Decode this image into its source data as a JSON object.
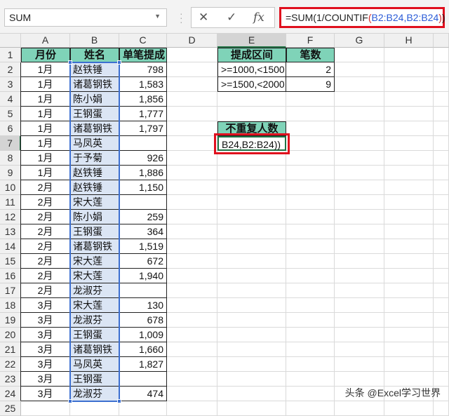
{
  "name_box": "SUM",
  "formula_bar": {
    "prefix": "=SUM(1/COUNTIF",
    "open": "(",
    "ref": "B2:B24,B2:B24",
    "close1": ")",
    "close2": ")"
  },
  "toolbar": {
    "cancel": "✕",
    "enter": "✓",
    "fx": "fx"
  },
  "columns": [
    "A",
    "B",
    "C",
    "D",
    "E",
    "F",
    "G",
    "H"
  ],
  "selected_column": "E",
  "selected_row": 7,
  "table": {
    "headers": [
      "月份",
      "姓名",
      "单笔提成"
    ],
    "rows": [
      [
        "1月",
        "赵铁锤",
        "798"
      ],
      [
        "1月",
        "诸葛钢铁",
        "1,583"
      ],
      [
        "1月",
        "陈小娟",
        "1,856"
      ],
      [
        "1月",
        "王钢蛋",
        "1,777"
      ],
      [
        "1月",
        "诸葛钢铁",
        "1,797"
      ],
      [
        "1月",
        "马凤英",
        ""
      ],
      [
        "1月",
        "于予菊",
        "926"
      ],
      [
        "1月",
        "赵铁锤",
        "1,886"
      ],
      [
        "2月",
        "赵铁锤",
        "1,150"
      ],
      [
        "2月",
        "宋大莲",
        ""
      ],
      [
        "2月",
        "陈小娟",
        "259"
      ],
      [
        "2月",
        "王钢蛋",
        "364"
      ],
      [
        "2月",
        "诸葛钢铁",
        "1,519"
      ],
      [
        "2月",
        "宋大莲",
        "672"
      ],
      [
        "2月",
        "宋大莲",
        "1,940"
      ],
      [
        "2月",
        "龙淑芬",
        ""
      ],
      [
        "3月",
        "宋大莲",
        "130"
      ],
      [
        "3月",
        "龙淑芬",
        "678"
      ],
      [
        "3月",
        "王钢蛋",
        "1,009"
      ],
      [
        "3月",
        "诸葛钢铁",
        "1,660"
      ],
      [
        "3月",
        "马凤英",
        "1,827"
      ],
      [
        "3月",
        "王钢蛋",
        ""
      ],
      [
        "3月",
        "龙淑芬",
        "474"
      ]
    ]
  },
  "summary": {
    "headers": [
      "提成区间",
      "笔数"
    ],
    "rows": [
      [
        ">=1000,<1500",
        "2"
      ],
      [
        ">=1500,<2000",
        "9"
      ]
    ]
  },
  "unique": {
    "header": "不重复人数",
    "edit_text": "B24,B2:B24))"
  },
  "watermark": "头条 @Excel学习世界"
}
